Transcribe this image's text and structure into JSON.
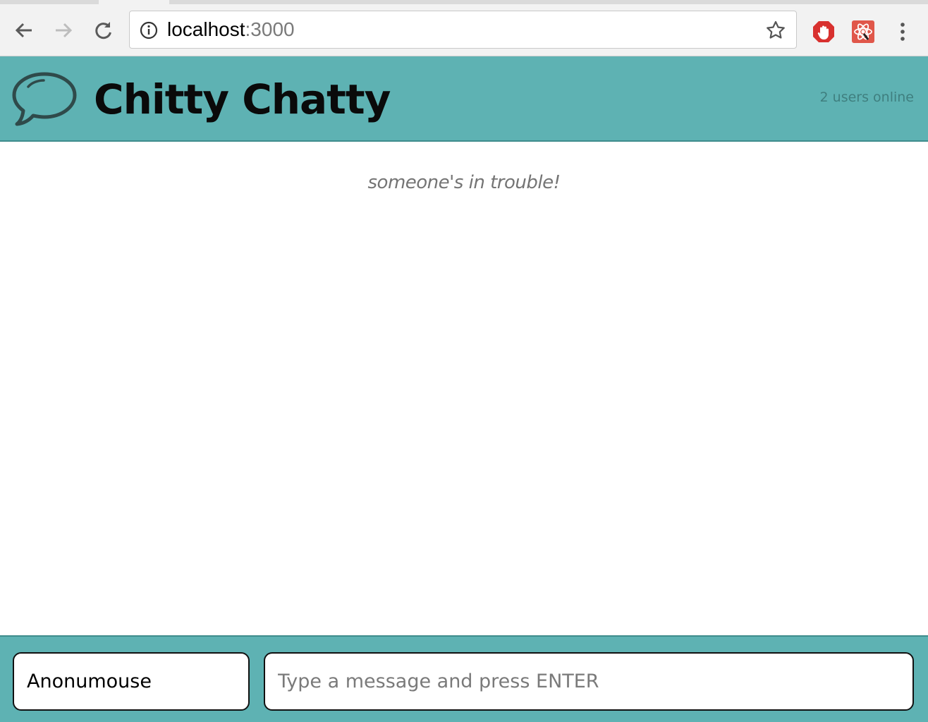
{
  "browser": {
    "url_host": "localhost",
    "url_port": ":3000",
    "icons": [
      "back-arrow-icon",
      "forward-arrow-icon",
      "reload-icon",
      "info-icon",
      "star-icon",
      "adblock-icon",
      "react-devtools-icon",
      "menu-dots-icon"
    ]
  },
  "header": {
    "title": "Chitty Chatty",
    "users_online": "2 users online",
    "logo_icon": "speech-bubble-icon"
  },
  "messages": [
    {
      "type": "system",
      "text": "someone's in trouble!"
    }
  ],
  "chatbar": {
    "username_value": "Anonumouse",
    "message_placeholder": "Type a message and press ENTER"
  },
  "colors": {
    "header_bg": "#5eb2b3",
    "system_text": "#747474"
  }
}
